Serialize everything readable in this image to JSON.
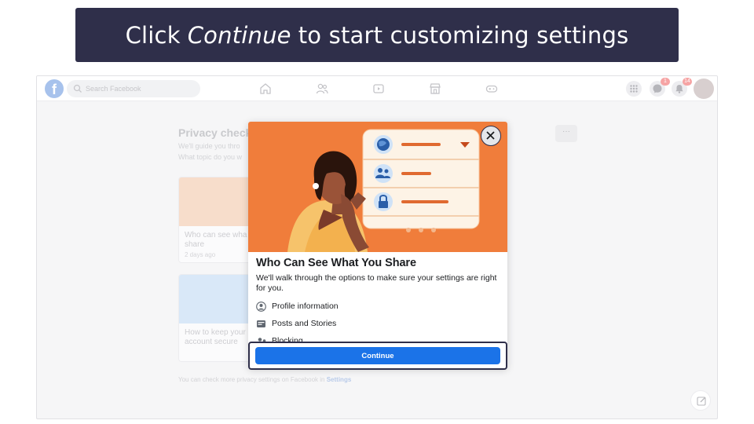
{
  "caption": {
    "prefix": "Click",
    "emphasis": "Continue",
    "suffix": "to start customizing settings"
  },
  "topbar": {
    "search_placeholder": "Search Facebook",
    "messenger_badge": "1",
    "notifications_badge": "14",
    "icons": [
      "facebook-logo",
      "search-icon",
      "home-icon",
      "friends-icon",
      "watch-icon",
      "marketplace-icon",
      "gaming-icon",
      "menu-grid-icon",
      "messenger-icon",
      "notifications-icon",
      "avatar"
    ]
  },
  "background": {
    "title": "Privacy check",
    "subtitle_1": "We'll guide you thro",
    "subtitle_2": "What topic do you w",
    "card1_text": "Who can see wha share",
    "card1_meta": "2 days ago",
    "card2_text": "How to keep your account secure",
    "footer_text": "You can check more privacy settings on Facebook in",
    "footer_link": "Settings",
    "dots": "···"
  },
  "modal": {
    "title": "Who Can See What You Share",
    "description": "We'll walk through the options to make sure your settings are right for you.",
    "items": [
      {
        "label": "Profile information",
        "icon": "profile-icon"
      },
      {
        "label": "Posts and Stories",
        "icon": "posts-icon"
      },
      {
        "label": "Blocking",
        "icon": "blocking-icon"
      }
    ],
    "continue_label": "Continue"
  },
  "colors": {
    "caption_bg": "#2f2f4a",
    "hero_orange": "#f07d3b",
    "accent_blue": "#1b73e8",
    "panel_bg": "#fdf3e6"
  }
}
